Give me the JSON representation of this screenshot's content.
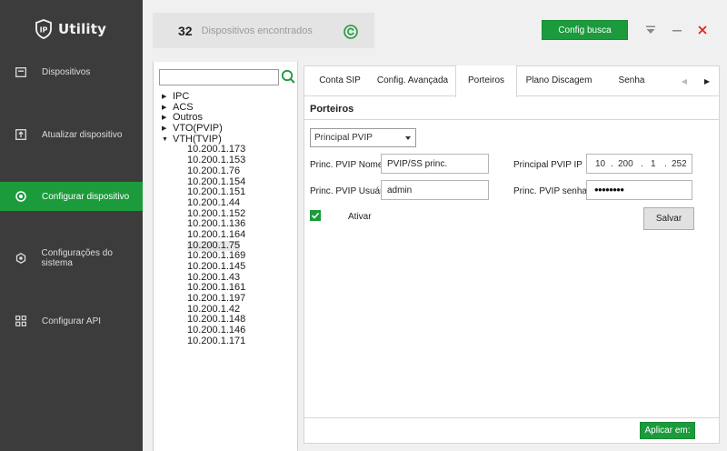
{
  "app": {
    "logo_mark": "IP",
    "logo_text": "Utility"
  },
  "sidebar": {
    "items": [
      {
        "label": "Dispositivos",
        "icon": "monitor-icon"
      },
      {
        "label": "Atualizar dispositivo",
        "icon": "upload-icon"
      },
      {
        "label": "Configurar dispositivo",
        "icon": "gear-circle-icon",
        "active": true
      },
      {
        "label": "Configurações do sistema",
        "icon": "settings-icon"
      },
      {
        "label": "Configurar API",
        "icon": "api-grid-icon"
      }
    ]
  },
  "header": {
    "device_count": "32",
    "device_count_label": "Dispositivos encontrados",
    "config_button": "Config busca"
  },
  "search": {
    "value": "",
    "placeholder": ""
  },
  "tree": {
    "groups": [
      {
        "label": "IPC",
        "expanded": false
      },
      {
        "label": "ACS",
        "expanded": false
      },
      {
        "label": "Outros",
        "expanded": false
      },
      {
        "label": "VTO(PVIP)",
        "expanded": false
      },
      {
        "label": "VTH(TVIP)",
        "expanded": true
      }
    ],
    "children": [
      "10.200.1.173",
      "10.200.1.153",
      "10.200.1.76",
      "10.200.1.154",
      "10.200.1.151",
      "10.200.1.44",
      "10.200.1.152",
      "10.200.1.136",
      "10.200.1.164",
      "10.200.1.75",
      "10.200.1.169",
      "10.200.1.145",
      "10.200.1.43",
      "10.200.1.161",
      "10.200.1.197",
      "10.200.1.42",
      "10.200.1.148",
      "10.200.1.146",
      "10.200.1.171"
    ],
    "selected": "10.200.1.75"
  },
  "tabs": [
    {
      "label": "Conta SIP"
    },
    {
      "label": "Config. Avançada"
    },
    {
      "label": "Porteiros",
      "active": true
    },
    {
      "label": "Plano Discagem"
    },
    {
      "label": "Senha"
    }
  ],
  "porteiros": {
    "title": "Porteiros",
    "select_value": "Principal PVIP",
    "nome_label": "Princ. PVIP Nome",
    "nome_value": "PVIP/SS princ.",
    "ip_label": "Principal PVIP IP",
    "ip": [
      "10",
      "200",
      "1",
      "252"
    ],
    "usuario_label": "Princ. PVIP Usuário",
    "usuario_value": "admin",
    "senha_label": "Princ. PVIP senha",
    "senha_mask": "••••••••",
    "ativar_label": "Ativar",
    "ativar_checked": true,
    "salvar_label": "Salvar"
  },
  "footer": {
    "aplicar_label": "Aplicar em:"
  },
  "colors": {
    "accent": "#1c9b3d",
    "sidebar_bg": "#3c3c3c",
    "close": "#e02020"
  }
}
